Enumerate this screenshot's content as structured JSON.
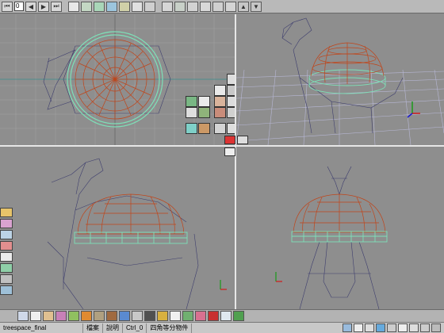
{
  "toolbar": {
    "frame_value": "0",
    "play_glyph": "▶",
    "prev_glyph": "◀",
    "end_glyph": "⏭",
    "start_glyph": "⏮",
    "icons": [
      "go-start-icon",
      "step-back-icon",
      "play-icon",
      "step-forward-icon",
      "go-end-icon",
      "layers-icon",
      "select-icon",
      "move-icon",
      "rotate-icon",
      "scale-icon",
      "render-icon",
      "grid-icon",
      "snap-icon",
      "sculpt-icon",
      "modify-icon",
      "lock-icon",
      "camera-icon",
      "save-icon",
      "up-arrow-icon",
      "down-arrow-icon"
    ]
  },
  "status": {
    "file": "treespace_final",
    "menu_file": "檔案",
    "menu_help": "說明",
    "mode": "Ctrl_0",
    "hint": "四角等分物件"
  },
  "colors": {
    "viewport_bg": "#8e8e8e",
    "grid": "#a8a8a8",
    "grid_tr": "#b4b4d4",
    "dome": "#c0451a",
    "ring": "#7ee0b8",
    "wire_body": "#3e3e6e",
    "selection": "#e00000"
  }
}
